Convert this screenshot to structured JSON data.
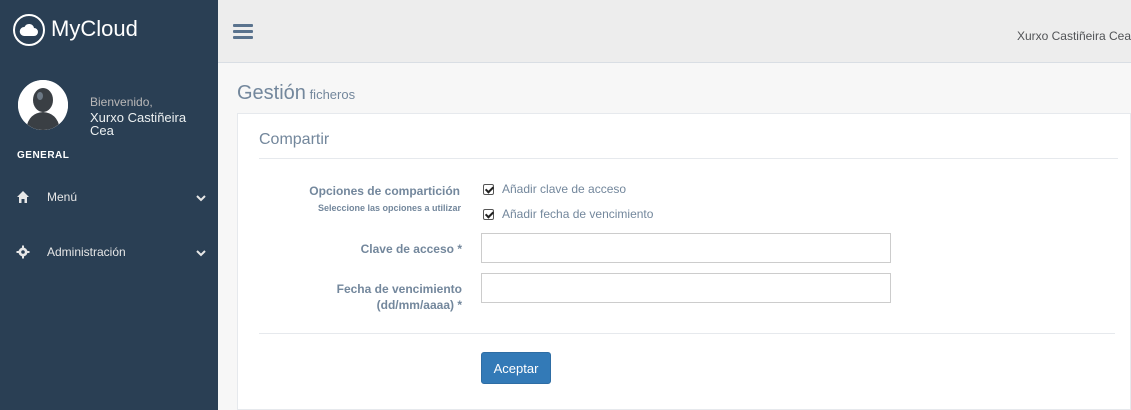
{
  "sidebar": {
    "site_title": "MyCloud",
    "welcome": "Bienvenido,",
    "username": "Xurxo Castiñeira Cea",
    "section": "GENERAL",
    "items": [
      {
        "label": "Menú",
        "icon": "home-icon"
      },
      {
        "label": "Administración",
        "icon": "cog-icon"
      }
    ]
  },
  "topnav": {
    "user_name": "Xurxo Castiñeira Cea"
  },
  "page": {
    "title": "Gestión",
    "subtitle": "ficheros"
  },
  "panel": {
    "title": "Compartir",
    "options_label": "Opciones de compartición",
    "options_hint": "Seleccione las opciones a utilizar",
    "options": [
      {
        "label": "Añadir clave de acceso",
        "checked": true
      },
      {
        "label": "Añadir fecha de vencimiento",
        "checked": true
      }
    ],
    "password_label": "Clave de acceso *",
    "password_value": "",
    "date_label_line1": "Fecha de vencimiento",
    "date_label_line2": "(dd/mm/aaaa) *",
    "date_value": "",
    "accept_label": "Aceptar"
  },
  "colors": {
    "sidebar_bg": "#2a3f54",
    "accent": "#337ab7"
  }
}
